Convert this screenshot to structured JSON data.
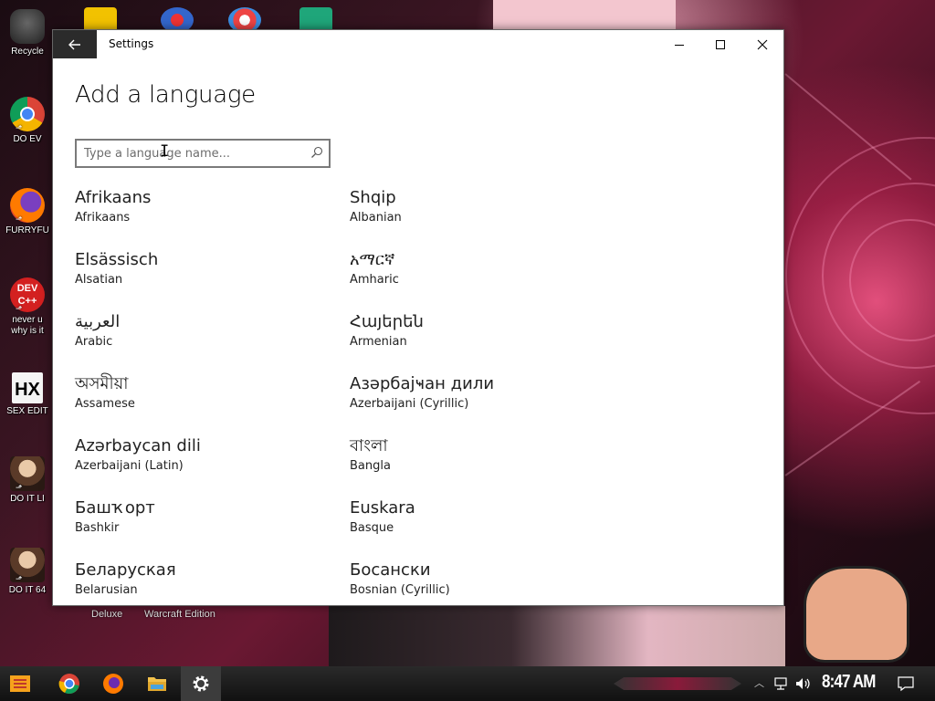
{
  "desktop": {
    "icons": [
      {
        "label": "Recycle",
        "icon": "recycle-bin-icon"
      },
      {
        "label": "DO EV",
        "icon": "chrome-icon"
      },
      {
        "label": "FURRYFU",
        "icon": "firefox-icon"
      },
      {
        "label": "never u",
        "label2": "why is it",
        "icon": "devcpp-icon"
      },
      {
        "label": "SEX EDIT",
        "icon": "hex-editor-icon"
      },
      {
        "label": "DO IT LI",
        "icon": "portrait-icon"
      },
      {
        "label": "DO IT 64",
        "icon": "portrait-icon"
      }
    ],
    "behind_labels": [
      "Deluxe",
      "Warcraft Edition"
    ]
  },
  "window": {
    "title": "Settings",
    "page_title": "Add a language",
    "search": {
      "placeholder": "Type a language name..."
    },
    "languages": [
      {
        "native": "Afrikaans",
        "english": "Afrikaans"
      },
      {
        "native": "Shqip",
        "english": "Albanian"
      },
      {
        "native": "Elsässisch",
        "english": "Alsatian"
      },
      {
        "native": "አማርኛ",
        "english": "Amharic"
      },
      {
        "native": "العربية",
        "english": "Arabic"
      },
      {
        "native": "Հայերեն",
        "english": "Armenian"
      },
      {
        "native": "অসমীয়া",
        "english": "Assamese"
      },
      {
        "native": "Азәрбајҹан дили",
        "english": "Azerbaijani (Cyrillic)"
      },
      {
        "native": "Azərbaycan dili",
        "english": "Azerbaijani (Latin)"
      },
      {
        "native": "বাংলা",
        "english": "Bangla"
      },
      {
        "native": "Башҡорт",
        "english": "Bashkir"
      },
      {
        "native": "Euskara",
        "english": "Basque"
      },
      {
        "native": "Беларуская",
        "english": "Belarusian"
      },
      {
        "native": "Босански",
        "english": "Bosnian (Cyrillic)"
      }
    ]
  },
  "taskbar": {
    "clock": "8:47 AM",
    "apps": [
      "start-icon",
      "chrome-icon",
      "firefox-icon",
      "file-explorer-icon",
      "settings-gear-icon"
    ]
  },
  "colors": {
    "back_button_bg": "#2b2b2b",
    "taskbar_bg": "#111111",
    "window_bg": "#ffffff"
  }
}
